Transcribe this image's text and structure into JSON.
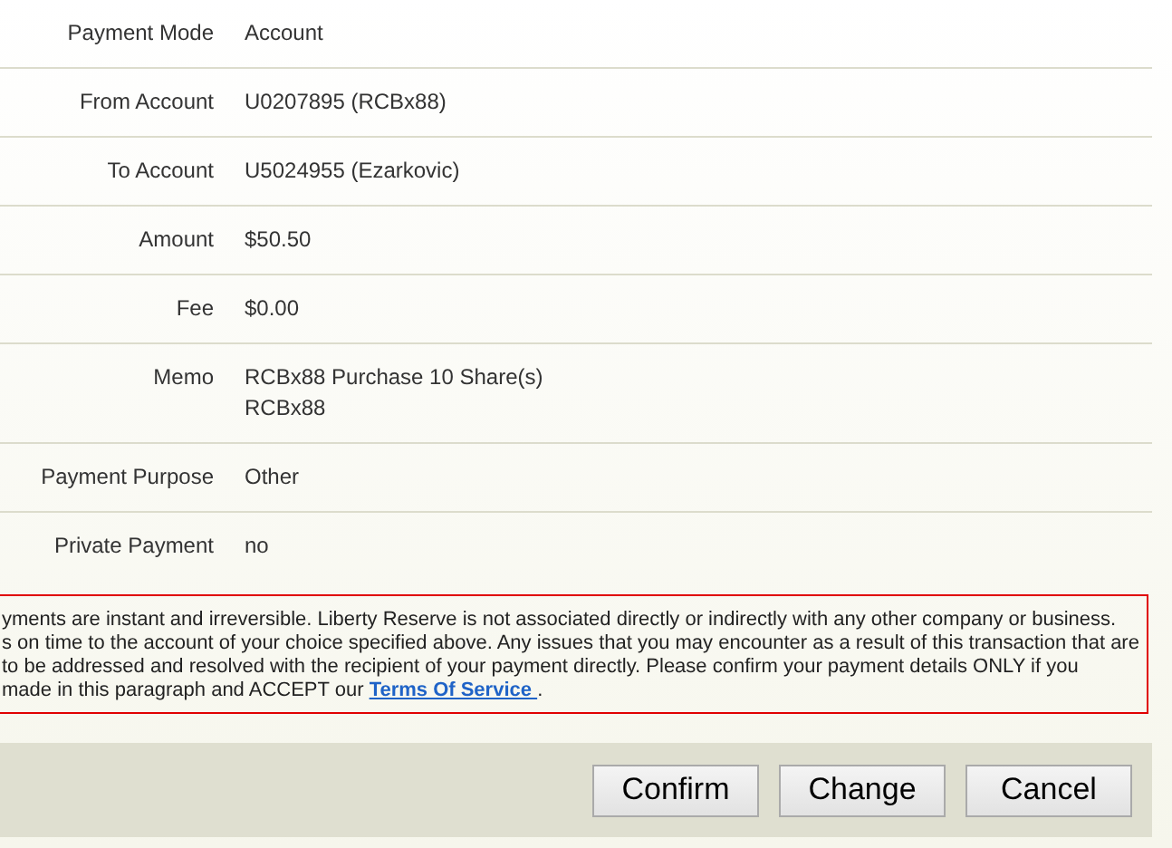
{
  "details": [
    {
      "label": "Payment Mode",
      "value": [
        "Account"
      ]
    },
    {
      "label": "From Account",
      "value": [
        "U0207895 (RCBx88)"
      ]
    },
    {
      "label": "To Account",
      "value": [
        "U5024955 (Ezarkovic)"
      ]
    },
    {
      "label": "Amount",
      "value": [
        "$50.50"
      ]
    },
    {
      "label": "Fee",
      "value": [
        "$0.00"
      ]
    },
    {
      "label": "Memo",
      "value": [
        "RCBx88 Purchase 10 Share(s)",
        "RCBx88"
      ]
    },
    {
      "label": "Payment Purpose",
      "value": [
        "Other"
      ]
    },
    {
      "label": "Private Payment",
      "value": [
        "no"
      ]
    }
  ],
  "notice": {
    "lines": [
      "yments are instant and irreversible. Liberty Reserve is not associated directly or indirectly with any other company or business.",
      "s on time to the account of your choice specified above. Any issues that you may encounter as a result of this transaction that are",
      "to be addressed and resolved with the recipient of your payment directly. Please confirm your payment details ONLY if you",
      "made in this paragraph and ACCEPT our"
    ],
    "link": "Terms Of Service",
    "after": "."
  },
  "buttons": [
    "Confirm",
    "Change",
    "Cancel"
  ]
}
